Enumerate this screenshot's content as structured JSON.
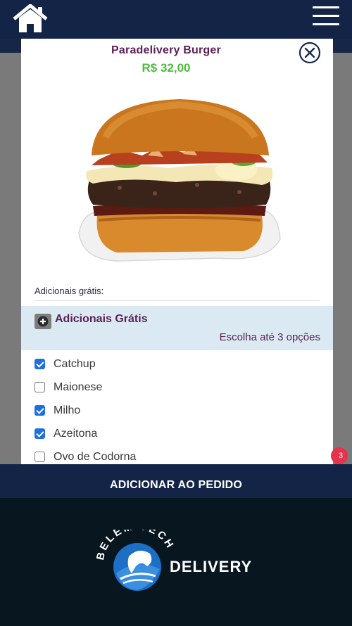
{
  "header": {
    "home_icon": "home-icon",
    "menu_icon": "hamburger-menu-icon"
  },
  "modal": {
    "product_name": "Paradelivery Burger",
    "product_price": "R$ 32,00",
    "close_icon": "close-circle-icon",
    "product_image": "burger-photo",
    "section_label": "Adicionais grátis:",
    "group": {
      "icon": "plus-circle-icon",
      "title": "Adicionais Grátis",
      "subtitle": "Escolha até 3 opções"
    },
    "options": [
      {
        "label": "Catchup",
        "checked": true
      },
      {
        "label": "Maionese",
        "checked": false
      },
      {
        "label": "Milho",
        "checked": true
      },
      {
        "label": "Azeitona",
        "checked": true
      },
      {
        "label": "Ovo de Codorna",
        "checked": false
      }
    ]
  },
  "cart_badge": "3",
  "add_button_label": "ADICIONAR AO PEDIDO",
  "footer": {
    "logo_text_arc": "BELEM TECH",
    "logo_text_side": "DELIVERY"
  },
  "colors": {
    "navy": "#132447",
    "title_purple": "#5a1f56",
    "price_green": "#4cbd3b",
    "checkbox_blue": "#1f6fe0",
    "group_bg": "#dbeaf2",
    "badge_red": "#e6324a"
  }
}
